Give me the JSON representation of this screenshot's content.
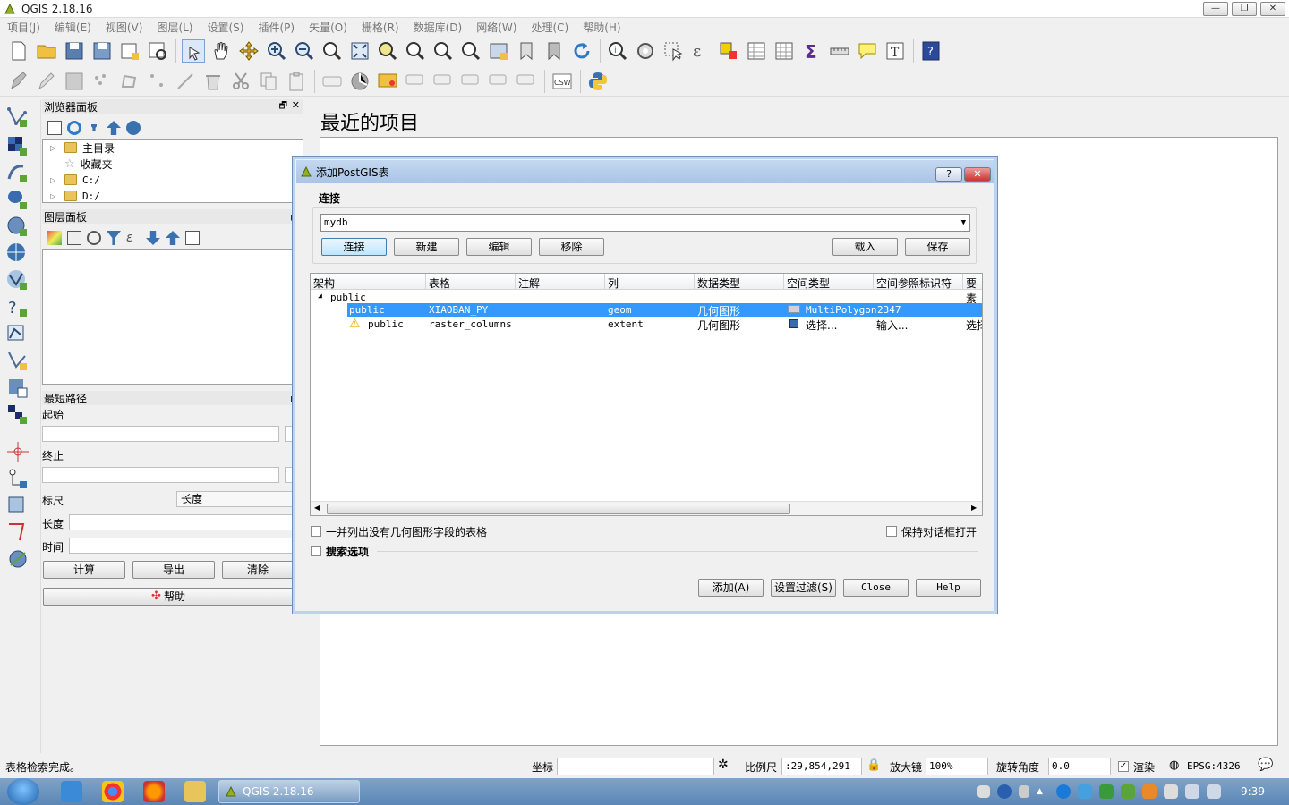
{
  "app": {
    "title": "QGIS 2.18.16",
    "window_buttons": [
      "—",
      "❐",
      "✕"
    ]
  },
  "menu": [
    "项目(J)",
    "编辑(E)",
    "视图(V)",
    "图层(L)",
    "设置(S)",
    "插件(P)",
    "矢量(O)",
    "栅格(R)",
    "数据库(D)",
    "网络(W)",
    "处理(C)",
    "帮助(H)"
  ],
  "browser_panel": {
    "title": "浏览器面板",
    "items": [
      {
        "label": "主目录",
        "expandable": true
      },
      {
        "label": "收藏夹",
        "expandable": false
      },
      {
        "label": "C:/",
        "expandable": true
      },
      {
        "label": "D:/",
        "expandable": true
      }
    ]
  },
  "layers_panel": {
    "title": "图层面板"
  },
  "shortest_path": {
    "title": "最短路径",
    "start_label": "起始",
    "end_label": "终止",
    "criterion_label": "标尺",
    "criterion_value": "长度",
    "length_label": "长度",
    "time_label": "时间",
    "calc_button": "计算",
    "export_button": "导出",
    "clear_button": "清除",
    "help_button": "帮助"
  },
  "recent": {
    "title": "最近的项目"
  },
  "dialog": {
    "title": "添加PostGIS表",
    "help_btn": "?",
    "close_btn": "✕",
    "connection_group": "连接",
    "connection_value": "mydb",
    "buttons": {
      "connect": "连接",
      "new": "新建",
      "edit": "编辑",
      "remove": "移除",
      "load": "载入",
      "save": "保存"
    },
    "columns": [
      "架构",
      "表格",
      "注解",
      "列",
      "数据类型",
      "空间类型",
      "空间参照标识符",
      "要素"
    ],
    "schema_node": "public",
    "rows": [
      {
        "schema": "public",
        "table": "XIAOBAN_PY",
        "comment": "",
        "column": "geom",
        "data_type": "几何图形",
        "spatial_type": "MultiPolygon",
        "srid": "2347",
        "feature": "",
        "selected": true,
        "warning": false
      },
      {
        "schema": "public",
        "table": "raster_columns",
        "comment": "",
        "column": "extent",
        "data_type": "几何图形",
        "spatial_type": "选择...",
        "srid": "输入...",
        "feature": "选择",
        "selected": false,
        "warning": true
      }
    ],
    "list_no_geom": "一并列出没有几何图形字段的表格",
    "keep_open": "保持对话框打开",
    "search_options": "搜索选项",
    "footer": {
      "add": "添加(A)",
      "filter": "设置过滤(S)",
      "close": "Close",
      "help": "Help"
    }
  },
  "status": {
    "message": "表格检索完成。",
    "coord_label": "坐标",
    "coord_value": "",
    "scale_label": "比例尺",
    "scale_value": ":29,854,291",
    "magnifier_label": "放大镜",
    "magnifier_value": "100%",
    "rotation_label": "旋转角度",
    "rotation_value": "0.0",
    "render_label": "渲染",
    "crs": "EPSG:4326"
  },
  "taskbar": {
    "qgis_task": "QGIS 2.18.16",
    "time": "9:39"
  },
  "colors": {
    "selection": "#3399ff",
    "dialog_title": "#b8cfec"
  }
}
